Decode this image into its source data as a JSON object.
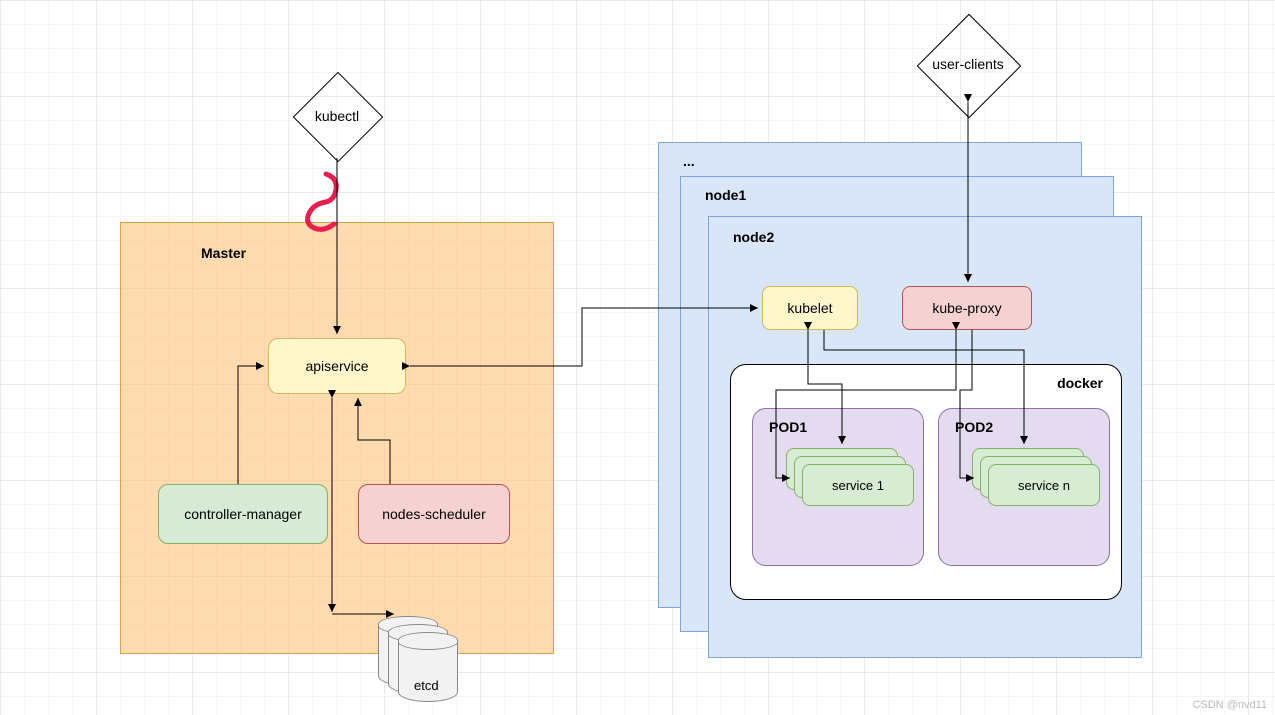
{
  "diamonds": {
    "kubectl": "kubectl",
    "userclients": "user-clients"
  },
  "master": {
    "title": "Master",
    "apiservice": "apiservice",
    "controller_manager": "controller-manager",
    "nodes_scheduler": "nodes-scheduler",
    "etcd": "etcd"
  },
  "nodes": {
    "ellipsis": "...",
    "node1": "node1",
    "node2": "node2",
    "kubelet": "kubelet",
    "kubeproxy": "kube-proxy",
    "docker": "docker",
    "pod1": {
      "title": "POD1",
      "service": "service 1"
    },
    "pod2": {
      "title": "POD2",
      "service": "service n"
    }
  },
  "watermark": "CSDN @nvd11"
}
